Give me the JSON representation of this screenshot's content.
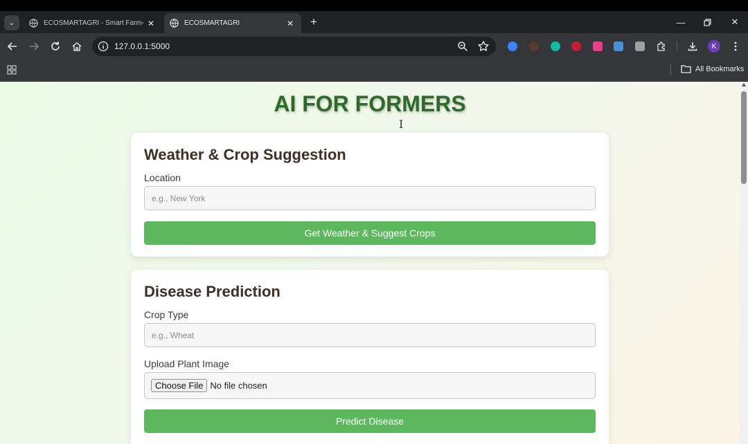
{
  "browser": {
    "tabs": [
      {
        "title": "ECOSMARTAGRI - Smart Farm-",
        "active": false
      },
      {
        "title": "ECOSMARTAGRI",
        "active": true
      }
    ],
    "address": "127.0.0.1:5000",
    "profile_initial": "K",
    "bookmarks_label": "All Bookmarks",
    "extension_colors": [
      "#3b82f6",
      "#5b3a29",
      "#10b9a8",
      "#c41e3a",
      "#e83e8c",
      "#4a90d9",
      "#9aa0a6"
    ]
  },
  "page": {
    "title": "AI FOR FORMERS",
    "weather_card": {
      "heading": "Weather & Crop Suggestion",
      "location_label": "Location",
      "location_placeholder": "e.g., New York",
      "button_label": "Get Weather & Suggest Crops"
    },
    "disease_card": {
      "heading": "Disease Prediction",
      "crop_label": "Crop Type",
      "crop_placeholder": "e.g., Wheat",
      "image_label": "Upload Plant Image",
      "file_button_label": "Choose File",
      "file_status": "No file chosen",
      "button_label": "Predict Disease"
    }
  }
}
